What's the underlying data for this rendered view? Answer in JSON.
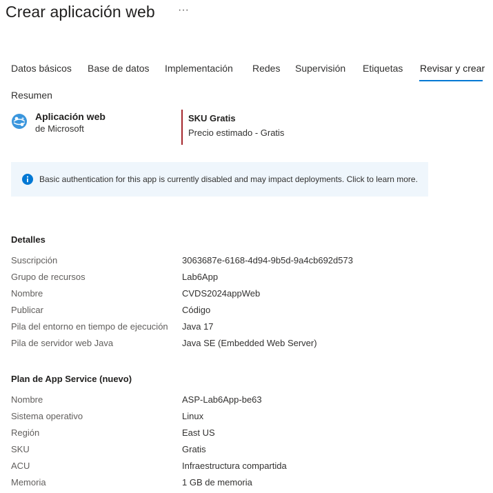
{
  "page": {
    "title": "Crear aplicación web",
    "more_icon": "more-horizontal-icon",
    "more_glyph": "···"
  },
  "tabs": [
    {
      "label": "Datos básicos"
    },
    {
      "label": "Base de datos"
    },
    {
      "label": "Implementación"
    },
    {
      "label": "Redes"
    },
    {
      "label": "Supervisión"
    },
    {
      "label": "Etiquetas"
    },
    {
      "label": "Revisar y crear",
      "active": true
    }
  ],
  "summary": {
    "heading": "Resumen",
    "app_name": "Aplicación web",
    "publisher": "de Microsoft",
    "sku_title": "SKU Gratis",
    "price": "Precio estimado - Gratis"
  },
  "banner": {
    "icon": "info-icon",
    "text": "Basic authentication for this app is currently disabled and may impact deployments. Click to learn more."
  },
  "details": {
    "heading": "Detalles",
    "rows": [
      {
        "key": "Suscripción",
        "value": "3063687e-6168-4d94-9b5d-9a4cb692d573"
      },
      {
        "key": "Grupo de recursos",
        "value": "Lab6App"
      },
      {
        "key": "Nombre",
        "value": "CVDS2024appWeb"
      },
      {
        "key": "Publicar",
        "value": "Código"
      },
      {
        "key": "Pila del entorno en tiempo de ejecución",
        "value": "Java 17"
      },
      {
        "key": "Pila de servidor web Java",
        "value": "Java SE (Embedded Web Server)"
      }
    ]
  },
  "plan": {
    "heading": "Plan de App Service (nuevo)",
    "rows": [
      {
        "key": "Nombre",
        "value": "ASP-Lab6App-be63"
      },
      {
        "key": "Sistema operativo",
        "value": "Linux"
      },
      {
        "key": "Región",
        "value": "East US"
      },
      {
        "key": "SKU",
        "value": "Gratis"
      },
      {
        "key": "ACU",
        "value": "Infraestructura compartida"
      },
      {
        "key": "Memoria",
        "value": "1 GB de memoria"
      }
    ]
  },
  "colors": {
    "accent": "#0078d4",
    "sku_bar": "#a4262c",
    "banner_bg": "#eff6fc"
  }
}
